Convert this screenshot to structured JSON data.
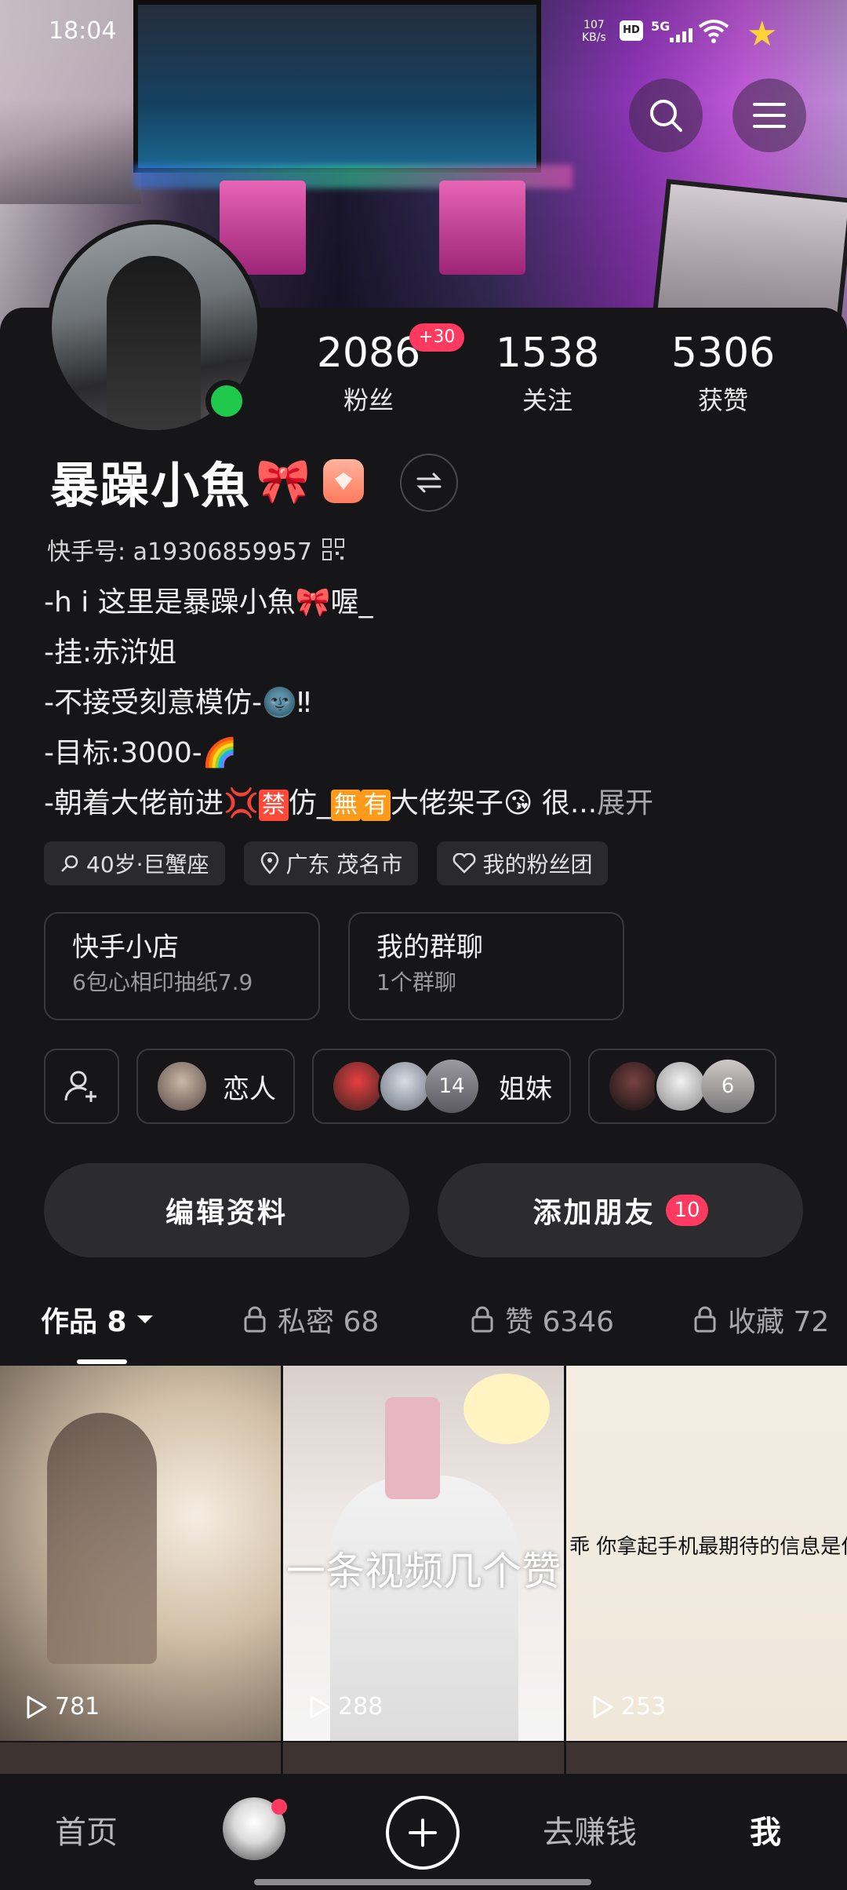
{
  "status_bar": {
    "time": "18:04",
    "net_speed": "107",
    "net_unit": "KB/s",
    "hd": "HD",
    "network": "5G"
  },
  "profile": {
    "stats": [
      {
        "value": "2086",
        "label": "粉丝",
        "badge": "+30"
      },
      {
        "value": "1538",
        "label": "关注"
      },
      {
        "value": "5306",
        "label": "获赞"
      }
    ],
    "name": "暴躁小魚",
    "name_emoji": "🎀",
    "kuaishou_id": "快手号: a19306859957",
    "bio": {
      "line1": "-h i 这里是暴躁小魚🎀喔_",
      "line2": "-挂:赤浒姐",
      "line3": "-不接受刻意模仿-🌚‼",
      "line4": "-目标:3000-🌈",
      "line5_a": "-朝着大佬前进💢",
      "line5_b": "禁",
      "line5_c": "仿_",
      "line5_d": "無",
      "line5_e": "有",
      "line5_f": "大佬架子😘 很...",
      "more": "展开"
    },
    "tags": [
      "40岁·巨蟹座",
      "广东 茂名市",
      "我的粉丝团"
    ],
    "shop": {
      "title": "快手小店",
      "subtitle": "6包心相印抽纸7.9"
    },
    "group_chat": {
      "title": "我的群聊",
      "subtitle": "1个群聊"
    },
    "groups": [
      {
        "name": "恋人"
      },
      {
        "name": "姐妹",
        "count": "14"
      },
      {
        "count": "6"
      }
    ],
    "edit_button": "编辑资料",
    "add_friend_button": "添加朋友",
    "add_friend_badge": "10"
  },
  "tabs": [
    {
      "label": "作品 8"
    },
    {
      "label": "私密 68"
    },
    {
      "label": "赞 6346"
    },
    {
      "label": "收藏 72"
    }
  ],
  "videos": [
    {
      "views": "781"
    },
    {
      "views": "288",
      "caption": "一条视频几个赞"
    },
    {
      "views": "253",
      "caption": "乖 你拿起手机最期待的信息是什"
    }
  ],
  "bottom_nav": {
    "home": "首页",
    "earn": "去赚钱",
    "me": "我"
  },
  "colors": {
    "background": "#161618",
    "accent_red": "#ff3a60",
    "online_green": "#1ec94c"
  }
}
